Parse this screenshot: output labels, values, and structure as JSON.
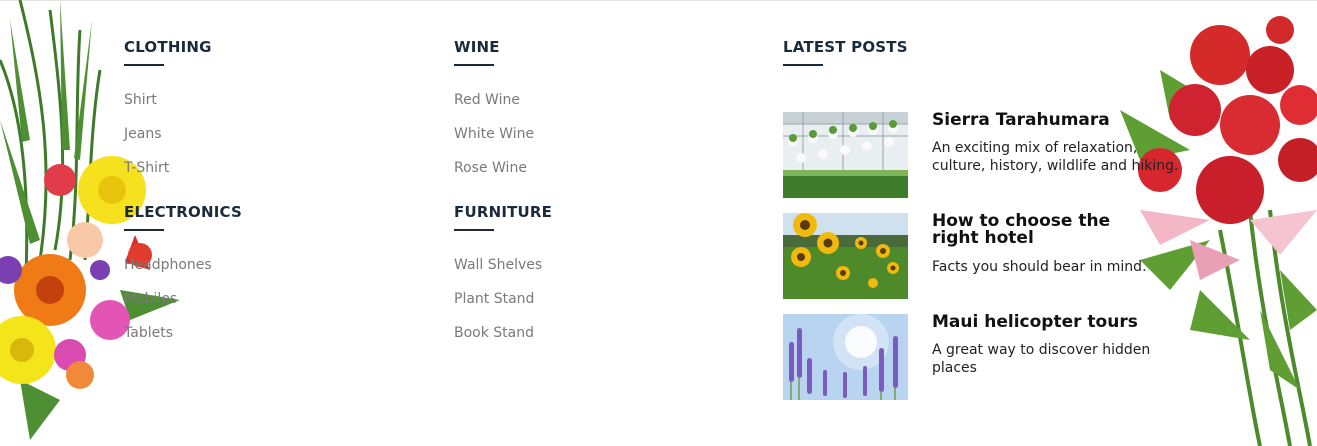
{
  "columns": [
    {
      "categories": [
        {
          "heading": "CLOTHING",
          "links": [
            "Shirt",
            "Jeans",
            "T-Shirt"
          ]
        },
        {
          "heading": "ELECTRONICS",
          "links": [
            "Headphones",
            "Mobiles",
            "Tablets"
          ]
        }
      ]
    },
    {
      "categories": [
        {
          "heading": "WINE",
          "links": [
            "Red Wine",
            "White Wine",
            "Rose Wine"
          ]
        },
        {
          "heading": "FURNITURE",
          "links": [
            "Wall Shelves",
            "Plant Stand",
            "Book Stand"
          ]
        }
      ]
    }
  ],
  "latest_posts": {
    "heading": "LATEST POSTS",
    "posts": [
      {
        "title": "Sierra Tarahumara",
        "description": "An exciting mix of relaxation, culture, history, wildlife and hiking.",
        "image": "greenhouse-image"
      },
      {
        "title": "How to choose the right hotel",
        "description": "Facts you should bear in mind.",
        "image": "sunflowers-image"
      },
      {
        "title": "Maui helicopter tours",
        "description": "A great way to discover hidden places",
        "image": "lavender-image"
      }
    ]
  },
  "colors": {
    "heading": "#1b2a3a",
    "link": "#7a7a7a",
    "text": "#222222"
  }
}
